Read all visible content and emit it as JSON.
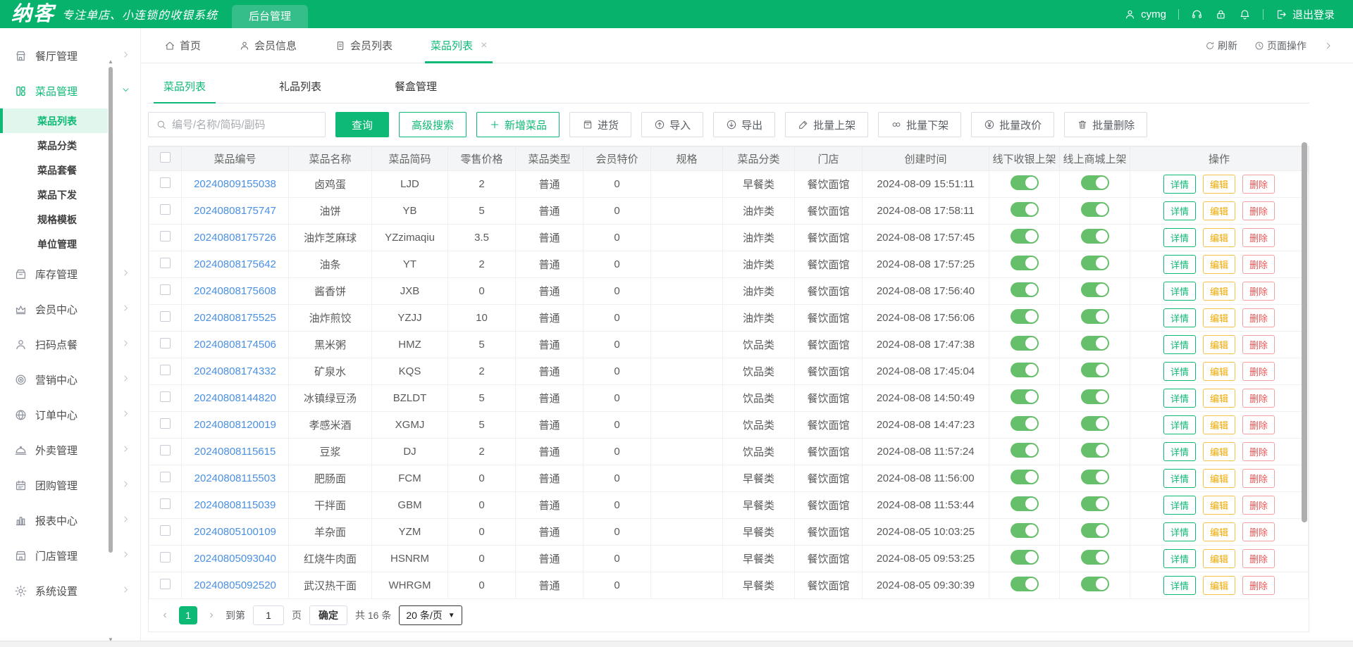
{
  "colors": {
    "accent": "#0eb875",
    "header_green": "#07b26d",
    "toggle_on": "#66bf6a",
    "link_blue": "#4a90e2",
    "edit_orange": "#f0a800",
    "delete_red": "#f05555"
  },
  "header": {
    "logo": "纳客",
    "tagline": "专注单店、小连锁的收银系统",
    "nav_tab": "后台管理",
    "username": "cymg",
    "logout_label": "退出登录"
  },
  "sidebar": {
    "groups": [
      {
        "label": "餐厅管理",
        "icon": "restaurant"
      },
      {
        "label": "菜品管理",
        "icon": "dish",
        "active": true,
        "expanded": true,
        "children": [
          {
            "label": "菜品列表",
            "active": true
          },
          {
            "label": "菜品分类"
          },
          {
            "label": "菜品套餐"
          },
          {
            "label": "菜品下发"
          },
          {
            "label": "规格模板"
          },
          {
            "label": "单位管理"
          }
        ]
      },
      {
        "label": "库存管理",
        "icon": "inventory"
      },
      {
        "label": "会员中心",
        "icon": "crown"
      },
      {
        "label": "扫码点餐",
        "icon": "person"
      },
      {
        "label": "营销中心",
        "icon": "target"
      },
      {
        "label": "订单中心",
        "icon": "globe"
      },
      {
        "label": "外卖管理",
        "icon": "cloche"
      },
      {
        "label": "团购管理",
        "icon": "calendar"
      },
      {
        "label": "报表中心",
        "icon": "chart"
      },
      {
        "label": "门店管理",
        "icon": "shop"
      },
      {
        "label": "系统设置",
        "icon": "gear"
      }
    ]
  },
  "tabbar": {
    "tabs": [
      {
        "label": "首页",
        "icon": "home"
      },
      {
        "label": "会员信息",
        "icon": "person"
      },
      {
        "label": "会员列表",
        "icon": "doc"
      },
      {
        "label": "菜品列表",
        "active": true,
        "closable": true
      }
    ],
    "refresh_label": "刷新",
    "page_ops_label": "页面操作"
  },
  "subtabs": {
    "items": [
      {
        "label": "菜品列表",
        "active": true
      },
      {
        "label": "礼品列表"
      },
      {
        "label": "餐盒管理"
      }
    ]
  },
  "toolbar": {
    "search_placeholder": "编号/名称/简码/副码",
    "buttons": [
      {
        "label": "查询",
        "style": "primary"
      },
      {
        "label": "高级搜索",
        "style": "green"
      },
      {
        "label": "新增菜品",
        "style": "green",
        "icon": "plus"
      },
      {
        "label": "进货",
        "style": "gray",
        "icon": "stock"
      },
      {
        "label": "导入",
        "style": "gray",
        "icon": "import"
      },
      {
        "label": "导出",
        "style": "gray",
        "icon": "export"
      },
      {
        "label": "批量上架",
        "style": "gray",
        "icon": "pencil"
      },
      {
        "label": "批量下架",
        "style": "gray",
        "icon": "unlink"
      },
      {
        "label": "批量改价",
        "style": "gray",
        "icon": "yen"
      },
      {
        "label": "批量删除",
        "style": "gray",
        "icon": "trash"
      }
    ]
  },
  "table": {
    "columns": [
      "菜品编号",
      "菜品名称",
      "菜品简码",
      "零售价格",
      "菜品类型",
      "会员特价",
      "规格",
      "菜品分类",
      "门店",
      "创建时间",
      "线下收银上架",
      "线上商城上架",
      "操作"
    ],
    "action_labels": [
      "详情",
      "编辑",
      "删除"
    ],
    "rows": [
      {
        "id": "20240809155038",
        "name": "卤鸡蛋",
        "code": "LJD",
        "price": "2",
        "type": "普通",
        "member_price": "0",
        "spec": "",
        "category": "早餐类",
        "store": "餐饮面馆",
        "created": "2024-08-09 15:51:11",
        "offline_on": true,
        "online_on": true
      },
      {
        "id": "20240808175747",
        "name": "油饼",
        "code": "YB",
        "price": "5",
        "type": "普通",
        "member_price": "0",
        "spec": "",
        "category": "油炸类",
        "store": "餐饮面馆",
        "created": "2024-08-08 17:58:11",
        "offline_on": true,
        "online_on": true
      },
      {
        "id": "20240808175726",
        "name": "油炸芝麻球",
        "code": "YZzimaqiu",
        "price": "3.5",
        "type": "普通",
        "member_price": "0",
        "spec": "",
        "category": "油炸类",
        "store": "餐饮面馆",
        "created": "2024-08-08 17:57:45",
        "offline_on": true,
        "online_on": true
      },
      {
        "id": "20240808175642",
        "name": "油条",
        "code": "YT",
        "price": "2",
        "type": "普通",
        "member_price": "0",
        "spec": "",
        "category": "油炸类",
        "store": "餐饮面馆",
        "created": "2024-08-08 17:57:25",
        "offline_on": true,
        "online_on": true
      },
      {
        "id": "20240808175608",
        "name": "酱香饼",
        "code": "JXB",
        "price": "0",
        "type": "普通",
        "member_price": "0",
        "spec": "",
        "category": "油炸类",
        "store": "餐饮面馆",
        "created": "2024-08-08 17:56:40",
        "offline_on": true,
        "online_on": true
      },
      {
        "id": "20240808175525",
        "name": "油炸煎饺",
        "code": "YZJJ",
        "price": "10",
        "type": "普通",
        "member_price": "0",
        "spec": "",
        "category": "油炸类",
        "store": "餐饮面馆",
        "created": "2024-08-08 17:56:06",
        "offline_on": true,
        "online_on": true
      },
      {
        "id": "20240808174506",
        "name": "黑米粥",
        "code": "HMZ",
        "price": "5",
        "type": "普通",
        "member_price": "0",
        "spec": "",
        "category": "饮品类",
        "store": "餐饮面馆",
        "created": "2024-08-08 17:47:38",
        "offline_on": true,
        "online_on": true
      },
      {
        "id": "20240808174332",
        "name": "矿泉水",
        "code": "KQS",
        "price": "2",
        "type": "普通",
        "member_price": "0",
        "spec": "",
        "category": "饮品类",
        "store": "餐饮面馆",
        "created": "2024-08-08 17:45:04",
        "offline_on": true,
        "online_on": true
      },
      {
        "id": "20240808144820",
        "name": "冰镇绿豆汤",
        "code": "BZLDT",
        "price": "5",
        "type": "普通",
        "member_price": "0",
        "spec": "",
        "category": "饮品类",
        "store": "餐饮面馆",
        "created": "2024-08-08 14:50:49",
        "offline_on": true,
        "online_on": true
      },
      {
        "id": "20240808120019",
        "name": "孝感米酒",
        "code": "XGMJ",
        "price": "5",
        "type": "普通",
        "member_price": "0",
        "spec": "",
        "category": "饮品类",
        "store": "餐饮面馆",
        "created": "2024-08-08 14:47:23",
        "offline_on": true,
        "online_on": true
      },
      {
        "id": "20240808115615",
        "name": "豆浆",
        "code": "DJ",
        "price": "2",
        "type": "普通",
        "member_price": "0",
        "spec": "",
        "category": "饮品类",
        "store": "餐饮面馆",
        "created": "2024-08-08 11:57:24",
        "offline_on": true,
        "online_on": true
      },
      {
        "id": "20240808115503",
        "name": "肥肠面",
        "code": "FCM",
        "price": "0",
        "type": "普通",
        "member_price": "0",
        "spec": "",
        "category": "早餐类",
        "store": "餐饮面馆",
        "created": "2024-08-08 11:56:00",
        "offline_on": true,
        "online_on": true
      },
      {
        "id": "20240808115039",
        "name": "干拌面",
        "code": "GBM",
        "price": "0",
        "type": "普通",
        "member_price": "0",
        "spec": "",
        "category": "早餐类",
        "store": "餐饮面馆",
        "created": "2024-08-08 11:53:44",
        "offline_on": true,
        "online_on": true
      },
      {
        "id": "20240805100109",
        "name": "羊杂面",
        "code": "YZM",
        "price": "0",
        "type": "普通",
        "member_price": "0",
        "spec": "",
        "category": "早餐类",
        "store": "餐饮面馆",
        "created": "2024-08-05 10:03:25",
        "offline_on": true,
        "online_on": true
      },
      {
        "id": "20240805093040",
        "name": "红烧牛肉面",
        "code": "HSNRM",
        "price": "0",
        "type": "普通",
        "member_price": "0",
        "spec": "",
        "category": "早餐类",
        "store": "餐饮面馆",
        "created": "2024-08-05 09:53:25",
        "offline_on": true,
        "online_on": true
      },
      {
        "id": "20240805092520",
        "name": "武汉热干面",
        "code": "WHRGM",
        "price": "0",
        "type": "普通",
        "member_price": "0",
        "spec": "",
        "category": "早餐类",
        "store": "餐饮面馆",
        "created": "2024-08-05 09:30:39",
        "offline_on": true,
        "online_on": true
      }
    ]
  },
  "pagination": {
    "prev": "‹",
    "current_page": "1",
    "next": "›",
    "goto_label": "到第",
    "goto_value": "1",
    "page_unit": "页",
    "confirm_label": "确定",
    "total_label": "共 16 条",
    "page_size": "20 条/页"
  }
}
